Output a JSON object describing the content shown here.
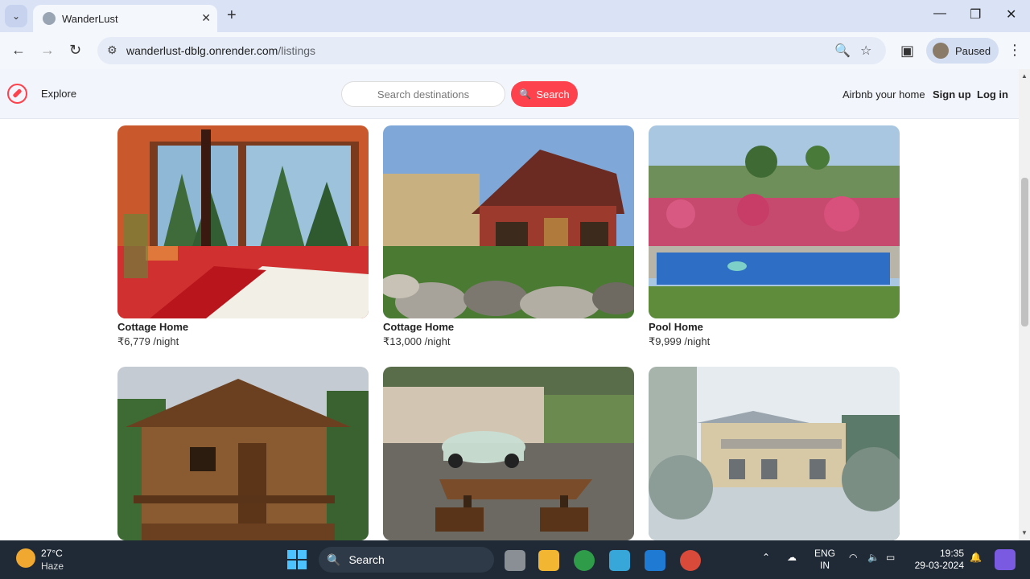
{
  "browser": {
    "tab_title": "WanderLust",
    "url_host": "wanderlust-dblg.onrender.com",
    "url_path": "/listings",
    "profile_label": "Paused"
  },
  "navbar": {
    "explore_label": "Explore",
    "search_placeholder": "Search destinations",
    "search_button_label": "Search",
    "airbnb_label": "Airbnb your home",
    "signup_label": "Sign up",
    "login_label": "Log in",
    "accent_color": "#fe424d"
  },
  "listings": [
    {
      "title": "Cottage Home",
      "price": "₹6,779 /night",
      "image": "bedroom-window-icon"
    },
    {
      "title": "Cottage Home",
      "price": "₹13,000 /night",
      "image": "red-cottage-icon"
    },
    {
      "title": "Pool Home",
      "price": "₹9,999 /night",
      "image": "pool-icon"
    },
    {
      "title": "",
      "price": "",
      "image": "wooden-hut-icon"
    },
    {
      "title": "",
      "price": "",
      "image": "courtyard-car-icon"
    },
    {
      "title": "",
      "price": "",
      "image": "snowy-house-icon"
    }
  ],
  "taskbar": {
    "temperature": "27°C",
    "condition": "Haze",
    "search_label": "Search",
    "lang_top": "ENG",
    "lang_bottom": "IN",
    "time": "19:35",
    "date": "29-03-2024"
  }
}
